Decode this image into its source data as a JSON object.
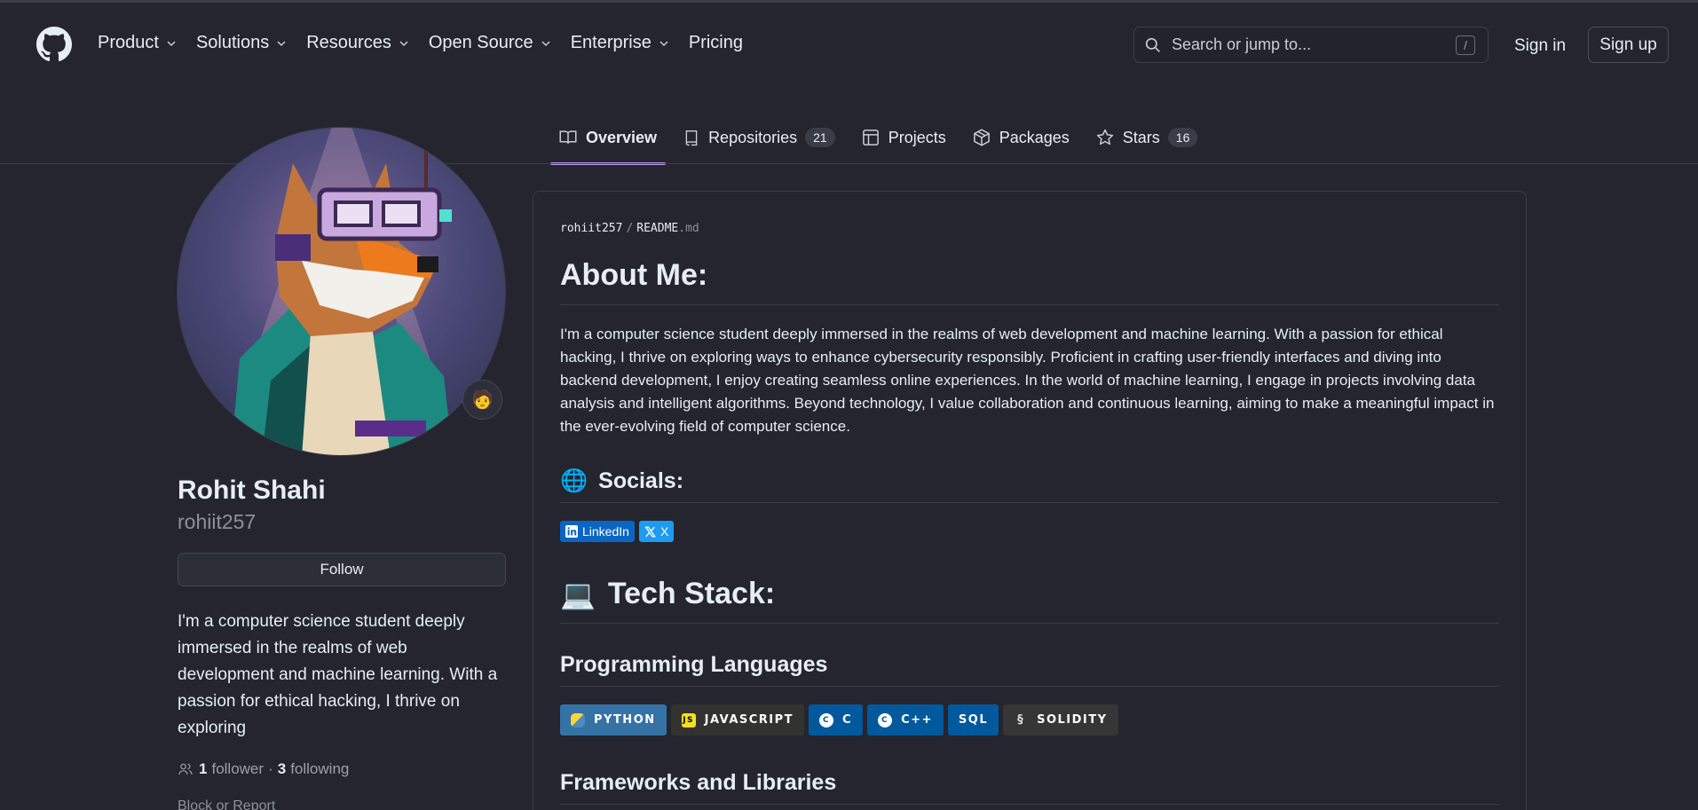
{
  "header": {
    "nav": [
      {
        "label": "Product",
        "dropdown": true
      },
      {
        "label": "Solutions",
        "dropdown": true
      },
      {
        "label": "Resources",
        "dropdown": true
      },
      {
        "label": "Open Source",
        "dropdown": true
      },
      {
        "label": "Enterprise",
        "dropdown": true
      },
      {
        "label": "Pricing",
        "dropdown": false
      }
    ],
    "search_placeholder": "Search or jump to...",
    "search_shortcut": "/",
    "sign_in": "Sign in",
    "sign_up": "Sign up"
  },
  "tabs": [
    {
      "label": "Overview",
      "active": true,
      "icon": "book-icon"
    },
    {
      "label": "Repositories",
      "count": "21",
      "icon": "repo-icon"
    },
    {
      "label": "Projects",
      "icon": "table-icon"
    },
    {
      "label": "Packages",
      "icon": "package-icon"
    },
    {
      "label": "Stars",
      "count": "16",
      "icon": "star-icon"
    }
  ],
  "profile": {
    "name": "Rohit Shahi",
    "username": "rohiit257",
    "follow": "Follow",
    "status_emoji": "🧑",
    "bio": "I'm a computer science student deeply immersed in the realms of web development and machine learning. With a passion for ethical hacking, I thrive on exploring",
    "followers_count": "1",
    "followers_label": "follower",
    "separator": "·",
    "following_count": "3",
    "following_label": "following",
    "block": "Block or Report"
  },
  "readme": {
    "owner": "rohiit257",
    "sep": "/",
    "file": "README",
    "ext": ".md",
    "about_title": "About Me:",
    "about_text": "I'm a computer science student deeply immersed in the realms of web development and machine learning. With a passion for ethical hacking, I thrive on exploring ways to enhance cybersecurity responsibly. Proficient in crafting user-friendly interfaces and diving into backend development, I enjoy creating seamless online experiences. In the world of machine learning, I engage in projects involving data analysis and intelligent algorithms. Beyond technology, I value collaboration and continuous learning, aiming to make a meaningful impact in the ever-evolving field of computer science.",
    "socials_emoji": "🌐",
    "socials_title": "Socials:",
    "social_badges": [
      {
        "label": "LinkedIn",
        "color": "#0a66c2"
      },
      {
        "label": "X",
        "color": "#1d9bf0"
      }
    ],
    "tech_emoji": "💻",
    "tech_title": "Tech Stack:",
    "prog_title": "Programming Languages",
    "languages": [
      {
        "label": "PYTHON",
        "bg": "#3572a5"
      },
      {
        "label": "JAVASCRIPT",
        "bg": "#323330"
      },
      {
        "label": "C",
        "bg": "#00599c"
      },
      {
        "label": "C++",
        "bg": "#00599c"
      },
      {
        "label": "SQL",
        "bg": "#00599c"
      },
      {
        "label": "SOLIDITY",
        "bg": "#363636"
      }
    ],
    "frameworks_title": "Frameworks and Libraries"
  },
  "colors": {
    "background": "#24252f",
    "tab_underline": "#c39bf2",
    "muted_text": "#8b929c"
  }
}
